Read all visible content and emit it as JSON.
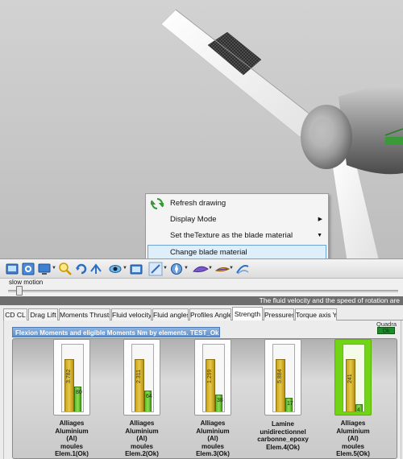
{
  "context_menu": {
    "items": [
      {
        "label": "Refresh drawing",
        "icon": "refresh-icon"
      },
      {
        "label": "Display Mode",
        "has_submenu": true
      },
      {
        "label": "Set theTexture as the blade material",
        "has_dropdown": true
      },
      {
        "label": "Change blade material",
        "highlighted": true
      }
    ]
  },
  "toolbar": {
    "icons": [
      "screenshot-icon",
      "settings-icon",
      "monitor-icon",
      "zoom-icon",
      "rotate-icon",
      "arrows-icon",
      "eye-icon",
      "camera-icon",
      "pencil-icon",
      "compass-icon",
      "blade-icon",
      "paint-icon",
      "flow-icon"
    ]
  },
  "slow_motion": {
    "label": "slow motion",
    "value": 0.02
  },
  "status_bar": {
    "text": "The fluid velocity and the speed of rotation are"
  },
  "tabs": [
    {
      "label": "CD CL"
    },
    {
      "label": "Drag Lift"
    },
    {
      "label": "Moments Thrusts"
    },
    {
      "label": "Fluid velocity"
    },
    {
      "label": "Fluid angles"
    },
    {
      "label": "Profiles Angles"
    },
    {
      "label": "Strength",
      "active": true
    },
    {
      "label": "Pressures"
    },
    {
      "label": "Torque axis Y"
    }
  ],
  "panel": {
    "title": "Flexion Moments and eligible Moments Nm by elements. TEST_Ok",
    "quadra_label": "Quadra",
    "quadra_value": "Ok"
  },
  "colors": {
    "ok_green": "#71d414",
    "bar_yellow": "#e8c84a",
    "bar_green": "#8ede54",
    "title_blue": "#6f9bd1",
    "status_bar": "#6e6e6e"
  },
  "chart_data": {
    "type": "bar",
    "title": "Flexion Moments and eligible Moments Nm by elements. TEST_Ok",
    "elements": [
      {
        "name": [
          "Alliages",
          "Aluminium",
          "(Al)",
          "moules",
          "Elem.1(Ok)"
        ],
        "eligible": 3782,
        "flexion": 80,
        "eligible_label": "3.782",
        "flexion_label": "80",
        "ok": true
      },
      {
        "name": [
          "Alliages",
          "Aluminium",
          "(Al)",
          "moules",
          "Elem.2(Ok)"
        ],
        "eligible": 2311,
        "flexion": 64,
        "eligible_label": "2.311",
        "flexion_label": "64",
        "ok": true
      },
      {
        "name": [
          "Alliages",
          "Aluminium",
          "(Al)",
          "moules",
          "Elem.3(Ok)"
        ],
        "eligible": 1299,
        "flexion": 38,
        "eligible_label": "1.299",
        "flexion_label": "38",
        "ok": true
      },
      {
        "name": [
          "Lamine",
          "unidirectionnel",
          "carbonne_epoxy",
          "Elem.4(Ok)"
        ],
        "eligible": 5884,
        "flexion": 17,
        "eligible_label": "5.884",
        "flexion_label": "17",
        "ok": true
      },
      {
        "name": [
          "Alliages",
          "Aluminium",
          "(Al)",
          "moules",
          "Elem.5(Ok)"
        ],
        "eligible": 241,
        "flexion": 4,
        "eligible_label": "241",
        "flexion_label": "4",
        "ok": true,
        "selected": true
      }
    ]
  }
}
